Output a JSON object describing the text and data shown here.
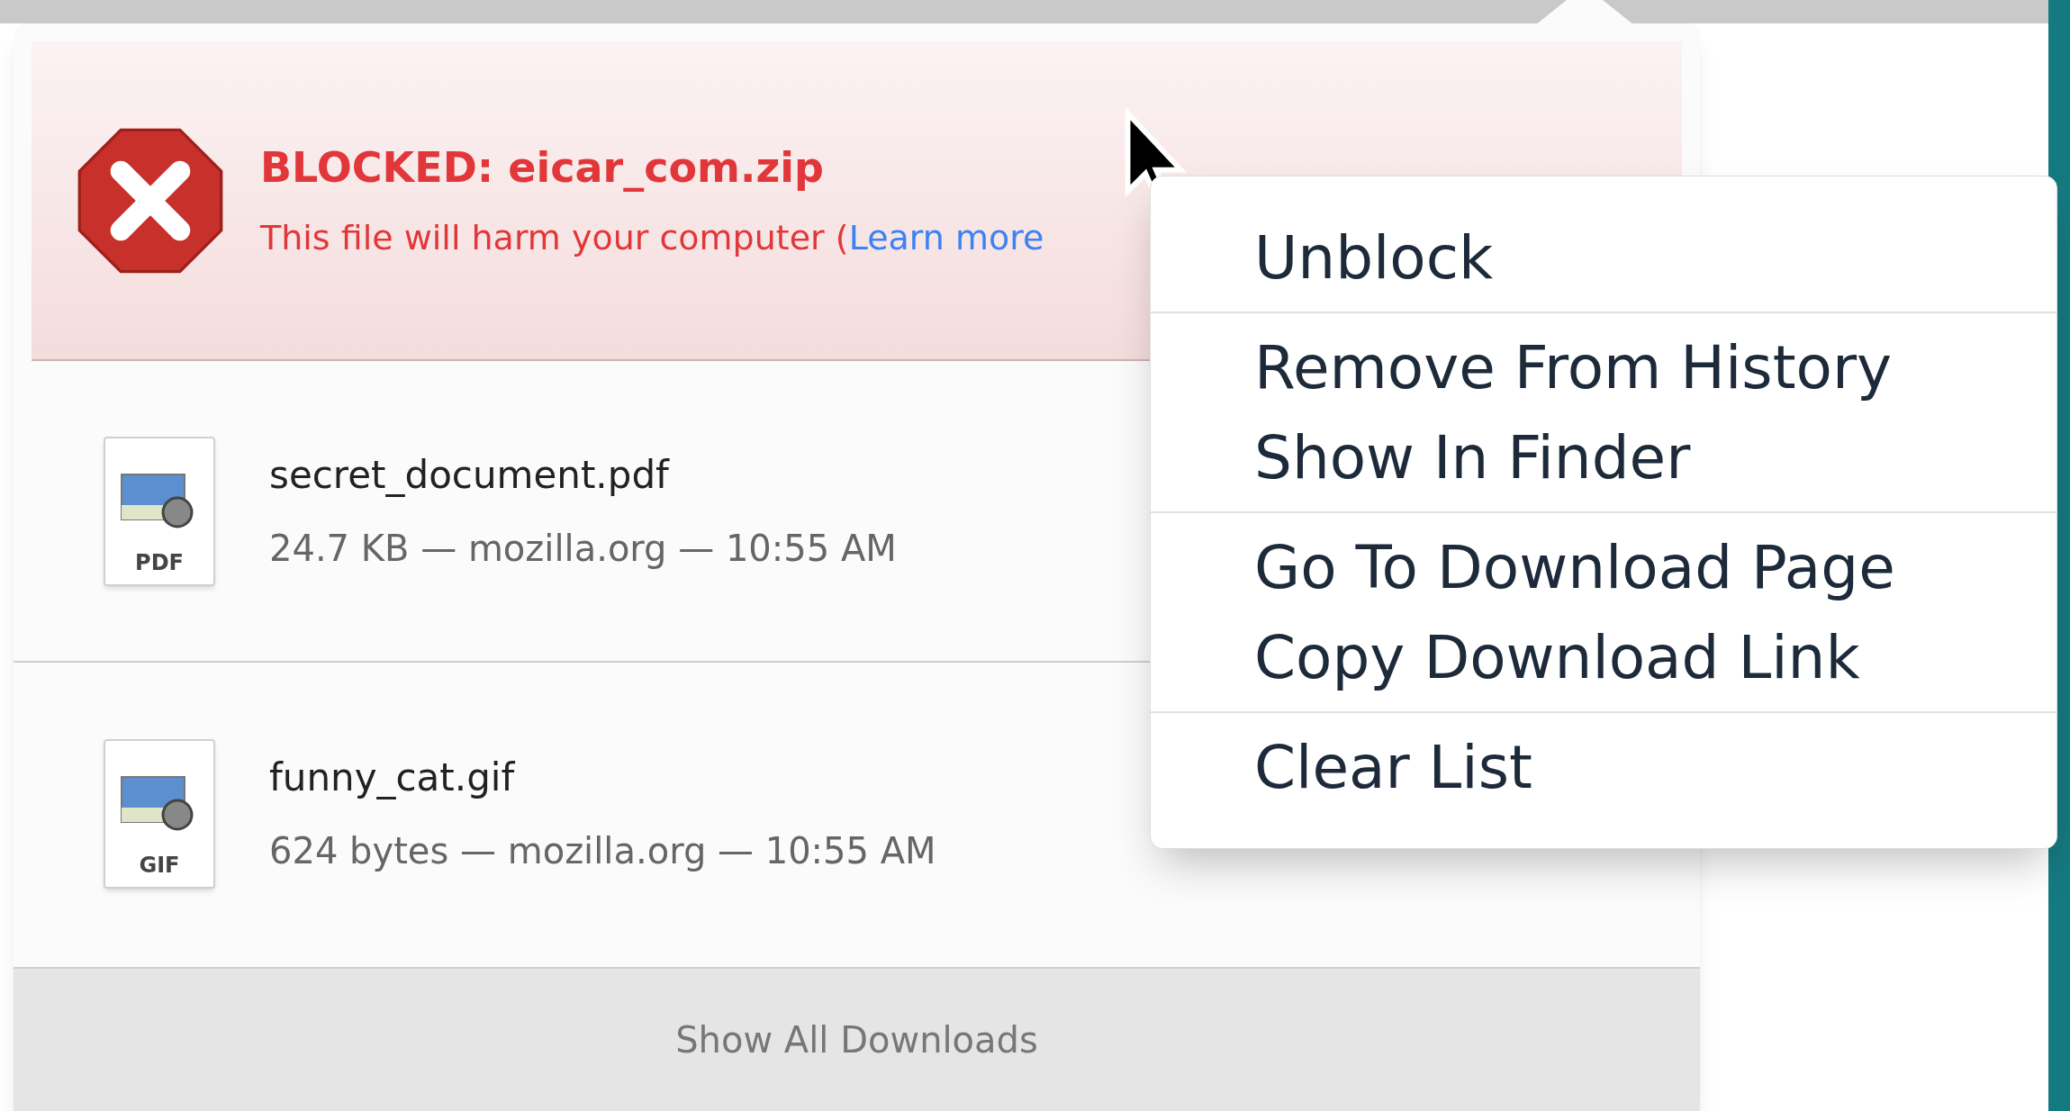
{
  "downloads": [
    {
      "kind": "blocked",
      "title": "BLOCKED: eicar_com.zip",
      "message": "This file will harm your computer (",
      "link": "Learn more"
    },
    {
      "kind": "file",
      "name": "secret_document.pdf",
      "file_type": "PDF",
      "details": "24.7 KB — mozilla.org — 10:55 AM"
    },
    {
      "kind": "file",
      "name": "funny_cat.gif",
      "file_type": "GIF",
      "details": "624 bytes — mozilla.org — 10:55 AM"
    }
  ],
  "footer": "Show All Downloads",
  "context_menu": {
    "groups": [
      {
        "items": [
          "Unblock"
        ]
      },
      {
        "items": [
          "Remove From History",
          "Show In Finder"
        ]
      },
      {
        "items": [
          "Go To Download Page",
          "Copy Download Link"
        ]
      },
      {
        "items": [
          "Clear List"
        ]
      }
    ]
  }
}
